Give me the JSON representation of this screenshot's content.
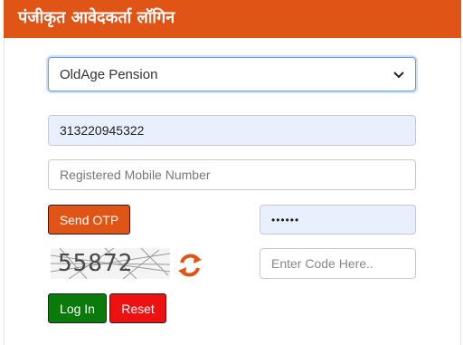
{
  "header": {
    "title": "पंजीकृत आवेदकर्ता लॉगिन"
  },
  "form": {
    "scheme_selected": "OldAge Pension",
    "application_id": "313220945322",
    "mobile_placeholder": "Registered Mobile Number",
    "otp_value": "••••••",
    "code_placeholder": "Enter Code Here..",
    "captcha_text": "55872"
  },
  "buttons": {
    "send_otp": "Send OTP",
    "login": "Log In",
    "reset": "Reset"
  },
  "icons": {
    "dropdown": "chevron-down-icon",
    "refresh": "refresh-icon"
  },
  "colors": {
    "header": "#e05416",
    "login": "#0a7a0a",
    "reset": "#ee1111",
    "send_otp": "#e05416"
  }
}
